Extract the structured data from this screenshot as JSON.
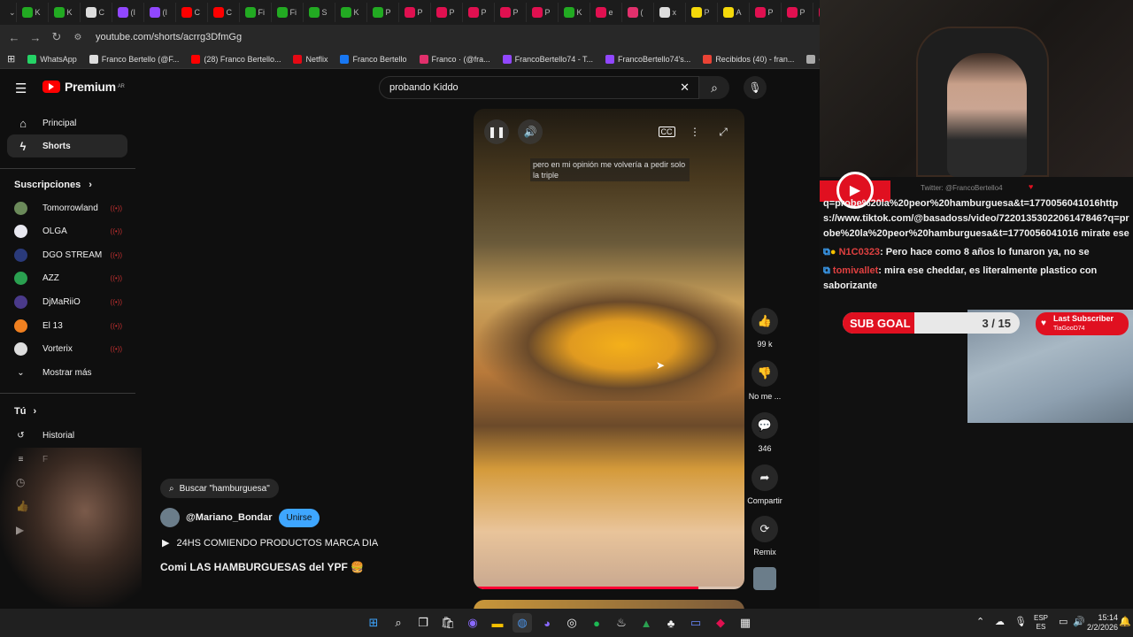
{
  "browser": {
    "tabs": [
      {
        "label": "K",
        "color": "#22aa22"
      },
      {
        "label": "K",
        "color": "#22aa22"
      },
      {
        "label": "C",
        "color": "#dddddd"
      },
      {
        "label": "(I",
        "color": "#9147ff"
      },
      {
        "label": "(I",
        "color": "#9147ff"
      },
      {
        "label": "C",
        "color": "#ff0000"
      },
      {
        "label": "C",
        "color": "#ff0000"
      },
      {
        "label": "Fi",
        "color": "#22aa22"
      },
      {
        "label": "Fi",
        "color": "#22aa22"
      },
      {
        "label": "S",
        "color": "#22aa22"
      },
      {
        "label": "K",
        "color": "#22aa22"
      },
      {
        "label": "P",
        "color": "#22aa22"
      },
      {
        "label": "P",
        "color": "#e01050"
      },
      {
        "label": "P",
        "color": "#e01050"
      },
      {
        "label": "P",
        "color": "#e01050"
      },
      {
        "label": "P",
        "color": "#e01050"
      },
      {
        "label": "P",
        "color": "#e01050"
      },
      {
        "label": "K",
        "color": "#22aa22"
      },
      {
        "label": "e",
        "color": "#e01050"
      },
      {
        "label": "(",
        "color": "#e1306c"
      },
      {
        "label": "x",
        "color": "#dddddd"
      },
      {
        "label": "P",
        "color": "#f5d90a"
      },
      {
        "label": "A",
        "color": "#f5d90a"
      },
      {
        "label": "P",
        "color": "#e01050"
      },
      {
        "label": "P",
        "color": "#e01050"
      },
      {
        "label": "P",
        "color": "#e01050"
      }
    ],
    "url": "youtube.com/shorts/acrrg3DfmGg",
    "bookmarks": [
      {
        "label": "WhatsApp",
        "color": "#25d366"
      },
      {
        "label": "Franco Bertello (@F...",
        "color": "#dddddd"
      },
      {
        "label": "(28) Franco Bertello...",
        "color": "#ff0000"
      },
      {
        "label": "Netflix",
        "color": "#e50914"
      },
      {
        "label": "Franco Bertello",
        "color": "#1877f2"
      },
      {
        "label": "Franco · (@fra...",
        "color": "#e1306c"
      },
      {
        "label": "FrancoBertello74 - T...",
        "color": "#9147ff"
      },
      {
        "label": "FrancoBertello74's...",
        "color": "#9147ff"
      },
      {
        "label": "Recibidos (40) - fran...",
        "color": "#ea4335"
      },
      {
        "label": "outlook",
        "color": "#aaaaaa"
      },
      {
        "label": "Aler",
        "color": "#22aa22"
      }
    ]
  },
  "youtube": {
    "logo_text": "Premium",
    "logo_region": "AR",
    "search_value": "probando Kiddo",
    "nav": [
      {
        "label": "Principal",
        "icon": "home-icon"
      },
      {
        "label": "Shorts",
        "icon": "shorts-icon"
      }
    ],
    "subscriptions_header": "Suscripciones",
    "subscriptions": [
      {
        "label": "Tomorrowland",
        "color": "#6b8a5a"
      },
      {
        "label": "OLGA",
        "color": "#e8e8f0"
      },
      {
        "label": "DGO STREAM",
        "color": "#2a3a7a"
      },
      {
        "label": "AZZ",
        "color": "#2aa050"
      },
      {
        "label": "DjMaRiiO",
        "color": "#4a3a8a"
      },
      {
        "label": "El 13",
        "color": "#f08020"
      },
      {
        "label": "Vorterix",
        "color": "#dddddd"
      }
    ],
    "show_more": "Mostrar más",
    "you_header": "Tú",
    "you_items": [
      {
        "label": "Historial"
      },
      {
        "label": "F"
      }
    ],
    "caption": "pero en mi opinión me volvería a pedir solo la triple",
    "progress_percent": 83,
    "actions": [
      {
        "label": "99 k",
        "icon": "like-icon"
      },
      {
        "label": "No me ...",
        "icon": "dislike-icon"
      },
      {
        "label": "346",
        "icon": "comment-icon"
      },
      {
        "label": "Compartir",
        "icon": "share-icon"
      },
      {
        "label": "Remix",
        "icon": "remix-icon"
      }
    ],
    "search_chip": "Buscar \"hamburguesa\"",
    "channel": "@Mariano_Bondar",
    "join_label": "Unirse",
    "playlist": "24HS COMIENDO PRODUCTOS MARCA DIA",
    "video_title": "Comi LAS HAMBURGUESAS del YPF 🍔"
  },
  "stream": {
    "twitter_handle": "Twitter: @FrancoBertello4",
    "chat_lines": [
      {
        "user": "",
        "text": "q=probe%20la%20peor%20hamburguesa&t=1770056041016https://www.tiktok.com/@basadoss/video/7220135302206147846?q=probe%20la%20peor%20hamburguesa&t=1770056041016 mirate ese"
      },
      {
        "user": "N1C0323",
        "text": ": Pero hace como 8 años lo funaron ya, no se"
      },
      {
        "user": "tomivallet",
        "text": ": mira ese cheddar, es literalmente plastico con saborizante"
      }
    ],
    "sub_goal_label": "SUB GOAL",
    "sub_goal_value": "3 / 15",
    "last_subscriber_label": "Last Subscriber",
    "last_subscriber_name": "TiaGooD74"
  },
  "taskbar": {
    "lang": "ESP",
    "region": "ES",
    "time": "15:14",
    "date": "2/2/2026"
  }
}
